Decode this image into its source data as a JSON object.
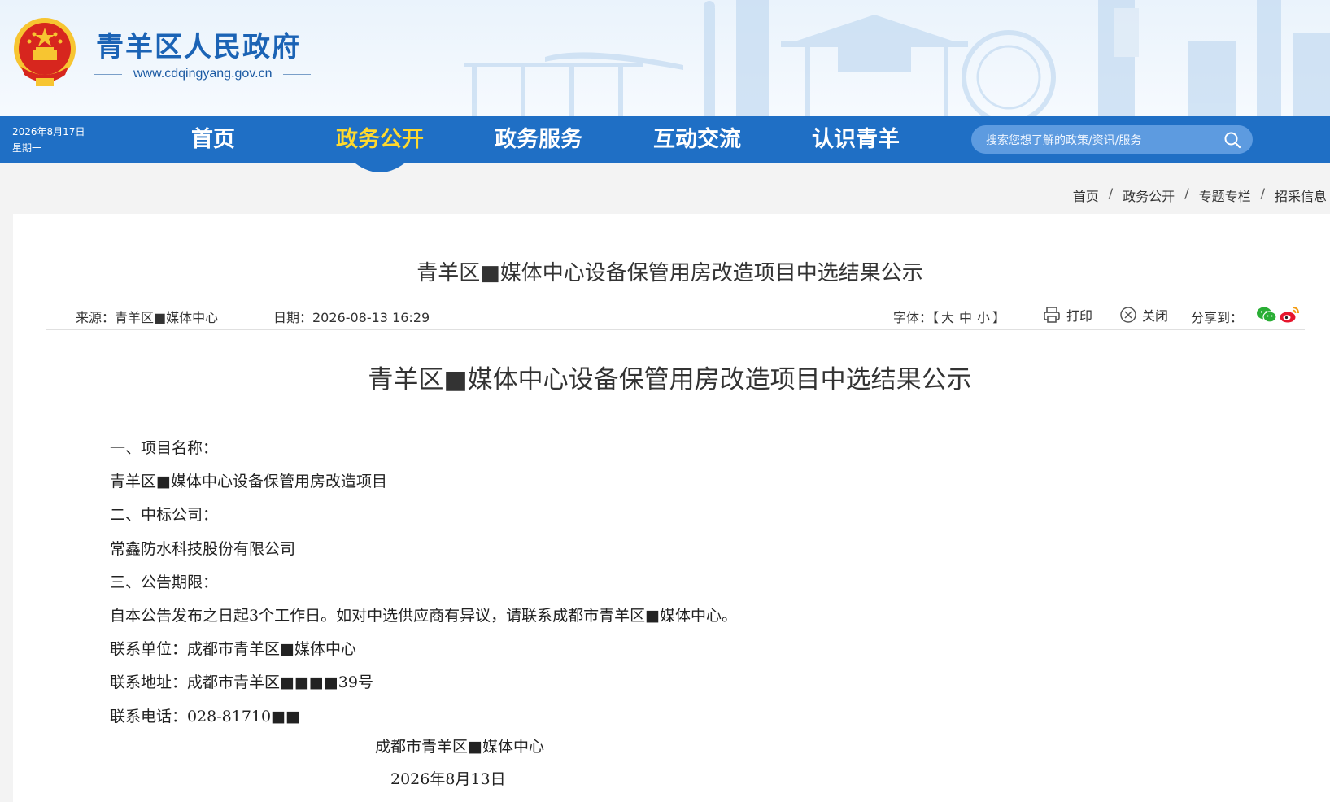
{
  "header": {
    "site_name": "青羊区人民政府",
    "site_url": "www.cdqingyang.gov.cn"
  },
  "nav": {
    "date": "2026年8月17日",
    "weekday": "星期一",
    "items": [
      {
        "label": "首页",
        "active": false
      },
      {
        "label": "政务公开",
        "active": true
      },
      {
        "label": "政务服务",
        "active": false
      },
      {
        "label": "互动交流",
        "active": false
      },
      {
        "label": "认识青羊",
        "active": false
      }
    ],
    "search_placeholder": "搜索您想了解的政策/资讯/服务",
    "active_color": "#ffd92e",
    "bar_color": "#1f6fc5"
  },
  "breadcrumb": [
    "首页",
    "政务公开",
    "专题专栏",
    "招采信息"
  ],
  "page_title": "青羊区■媒体中心设备保管用房改造项目中选结果公示",
  "meta": {
    "source": "来源：青羊区■媒体中心",
    "date": "日期：2026-08-13 16:29",
    "font_label": "字体：【",
    "font_large": "大",
    "font_medium": "中",
    "font_small": "小",
    "font_end": "】",
    "print": "打印",
    "close": "关闭",
    "share": "分享到："
  },
  "article": {
    "title": "青羊区■媒体中心设备保管用房改造项目中选结果公示",
    "lines": [
      "一、项目名称：",
      "青羊区■媒体中心设备保管用房改造项目",
      "二、中标公司：",
      "常鑫防水科技股份有限公司",
      "三、公告期限：",
      "自本公告发布之日起3个工作日。如对中选供应商有异议，请联系成都市青羊区■媒体中心。",
      "联系单位：成都市青羊区■媒体中心",
      "联系地址：成都市青羊区■■■■39号",
      "联系电话：028-81710■■"
    ],
    "signature_org": "成都市青羊区■媒体中心",
    "signature_date": "2026年8月13日"
  }
}
